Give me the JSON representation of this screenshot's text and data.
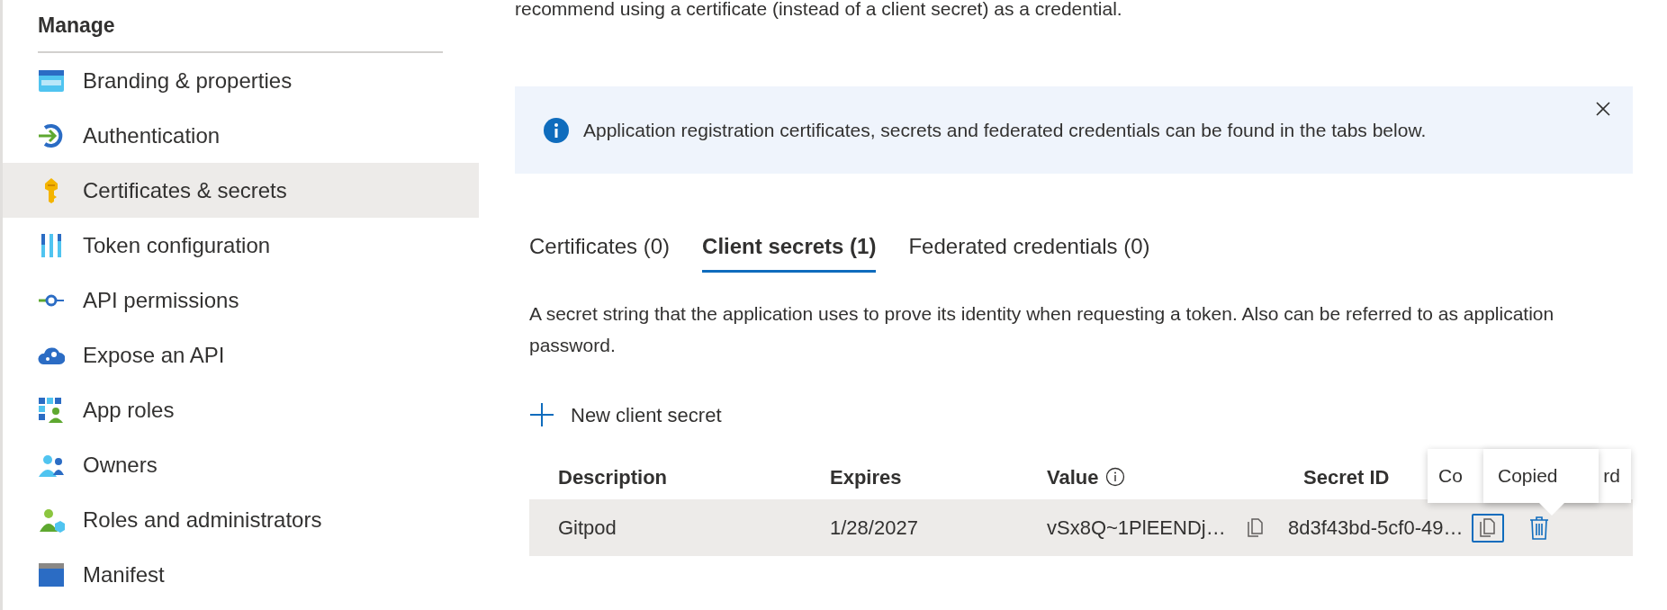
{
  "intro_text": "recommend using a certificate (instead of a client secret) as a credential.",
  "sidebar": {
    "heading": "Manage",
    "items": [
      {
        "label": "Branding & properties",
        "kind": "branding",
        "selected": false
      },
      {
        "label": "Authentication",
        "kind": "authentication",
        "selected": false
      },
      {
        "label": "Certificates & secrets",
        "kind": "key",
        "selected": true
      },
      {
        "label": "Token configuration",
        "kind": "token",
        "selected": false
      },
      {
        "label": "API permissions",
        "kind": "permissions",
        "selected": false
      },
      {
        "label": "Expose an API",
        "kind": "cloud",
        "selected": false
      },
      {
        "label": "App roles",
        "kind": "roles",
        "selected": false
      },
      {
        "label": "Owners",
        "kind": "owners",
        "selected": false
      },
      {
        "label": "Roles and administrators",
        "kind": "admins",
        "selected": false
      },
      {
        "label": "Manifest",
        "kind": "manifest",
        "selected": false
      }
    ]
  },
  "banner": {
    "message": "Application registration certificates, secrets and federated credentials can be found in the tabs below."
  },
  "tabs": [
    {
      "label": "Certificates (0)",
      "selected": false
    },
    {
      "label": "Client secrets (1)",
      "selected": true
    },
    {
      "label": "Federated credentials (0)",
      "selected": false
    }
  ],
  "description": "A secret string that the application uses to prove its identity when requesting a token. Also can be referred to as application password.",
  "new_button": "New client secret",
  "table": {
    "columns": [
      {
        "label": "Description",
        "info": false
      },
      {
        "label": "Expires",
        "info": false
      },
      {
        "label": "Value",
        "info": true
      },
      {
        "label": "Secret ID",
        "info": false
      }
    ],
    "rows": [
      {
        "description": "Gitpod",
        "expires": "1/28/2027",
        "value": "vSx8Q~1PlEENDj…",
        "secret_id": "8d3f43bd-5cf0-49…",
        "copy_focused": true
      }
    ]
  },
  "back_tooltip": {
    "start": "Co",
    "end": "rd"
  },
  "tooltip": "Copied"
}
